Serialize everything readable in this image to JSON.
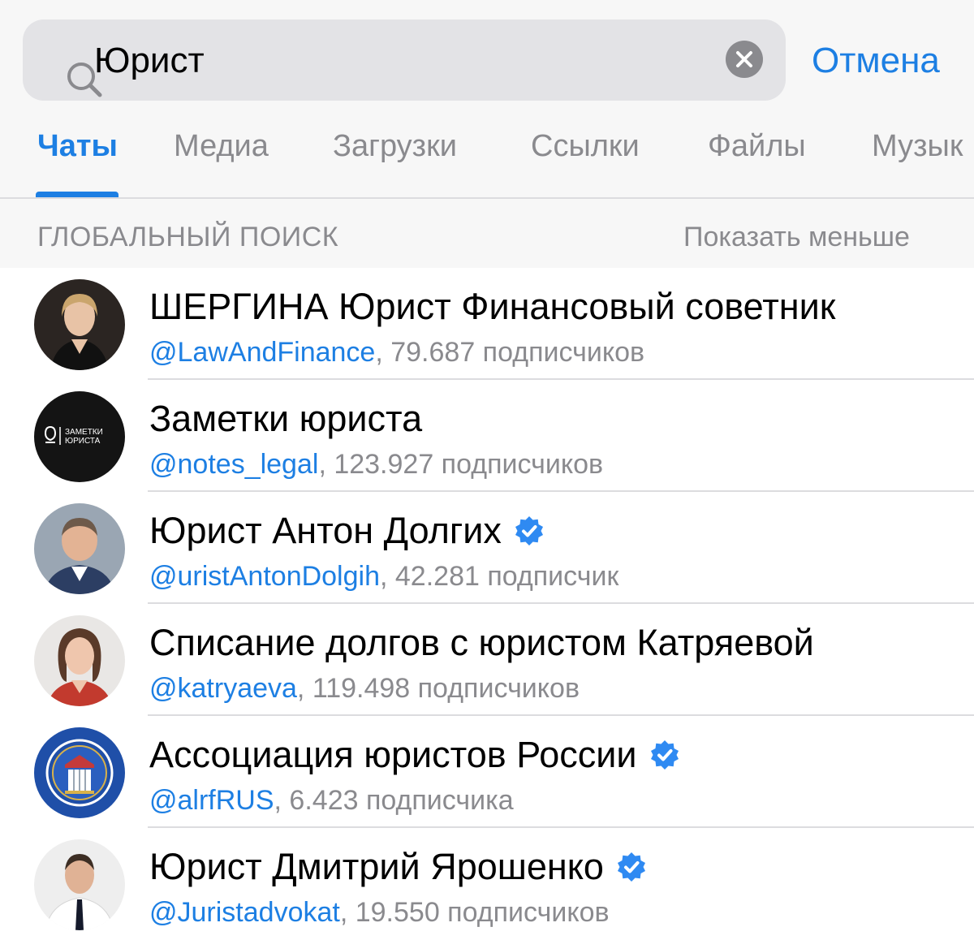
{
  "search": {
    "value": "Юрист",
    "cancel_label": "Отмена"
  },
  "tabs": [
    {
      "label": "Чаты",
      "active": true
    },
    {
      "label": "Медиа",
      "active": false
    },
    {
      "label": "Загрузки",
      "active": false
    },
    {
      "label": "Ссылки",
      "active": false
    },
    {
      "label": "Файлы",
      "active": false
    },
    {
      "label": "Музык",
      "active": false
    }
  ],
  "section": {
    "title": "ГЛОБАЛЬНЫЙ ПОИСК",
    "show_less": "Показать меньше"
  },
  "results": [
    {
      "title": "ШЕРГИНА Юрист Финансовый советник",
      "handle": "@LawAndFinance",
      "count": ", 79.687 подписчиков",
      "verified": false,
      "avatar_icon": "woman-portrait-avatar"
    },
    {
      "title": "Заметки юриста",
      "handle": "@notes_legal",
      "count": ", 123.927 подписчиков",
      "verified": false,
      "avatar_icon": "notes-logo-avatar",
      "avatar_text_1": "ЗАМЕТКИ",
      "avatar_text_2": "ЮРИСТА"
    },
    {
      "title": "Юрист Антон Долгих",
      "handle": "@uristAntonDolgih",
      "count": ", 42.281 подписчик",
      "verified": true,
      "avatar_icon": "man-portrait-avatar"
    },
    {
      "title": "Списание долгов с юристом Катряевой",
      "handle": "@katryaeva",
      "count": ", 119.498 подписчиков",
      "verified": false,
      "avatar_icon": "woman-portrait-avatar"
    },
    {
      "title": "Ассоциация юристов России",
      "handle": "@alrfRUS",
      "count": ", 6.423 подписчика",
      "verified": true,
      "avatar_icon": "association-emblem-avatar"
    },
    {
      "title": "Юрист Дмитрий Ярошенко",
      "handle": "@Juristadvokat",
      "count": ", 19.550 подписчиков",
      "verified": true,
      "avatar_icon": "man-portrait-avatar"
    }
  ],
  "colors": {
    "accent": "#1d7fe3",
    "secondary_text": "#8a8a8e",
    "verified": "#2f8af2"
  }
}
